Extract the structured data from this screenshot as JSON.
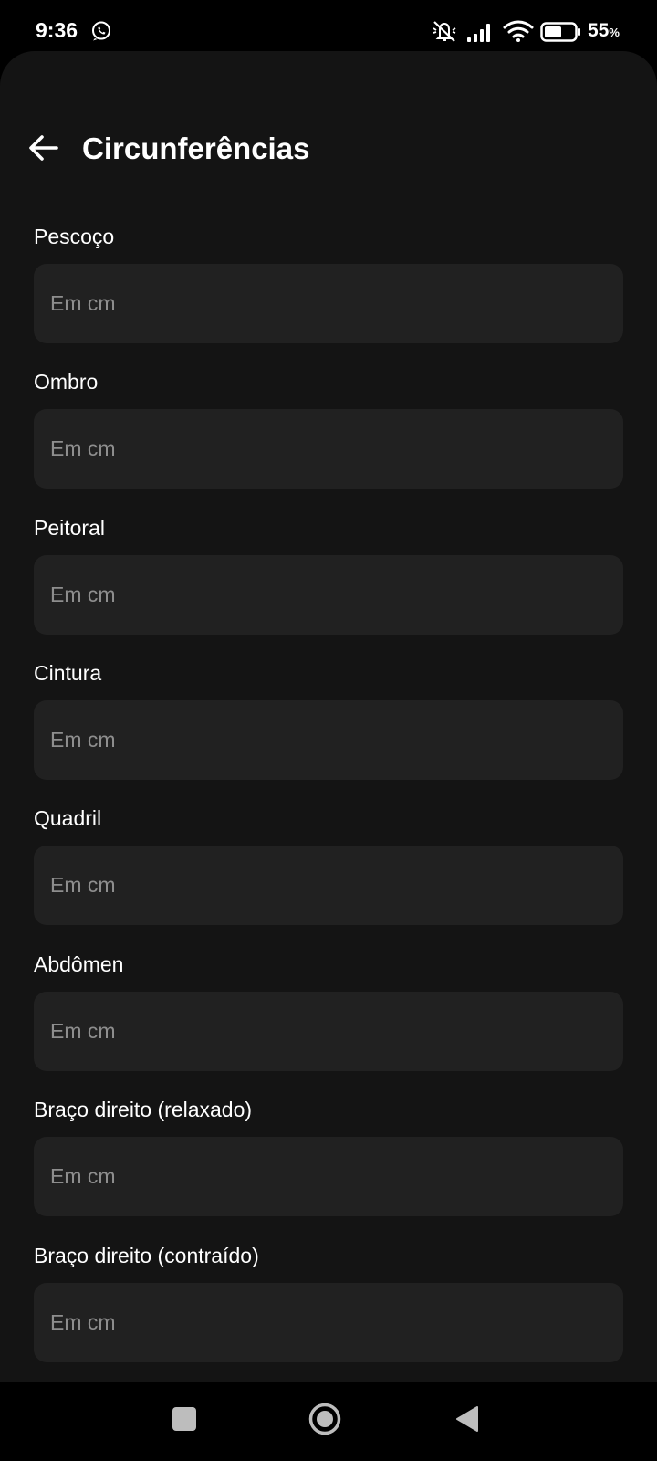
{
  "status_bar": {
    "time": "9:36",
    "battery_level": "55",
    "battery_unit": "%",
    "icons": [
      "whatsapp-icon",
      "mute-icon",
      "signal-icon",
      "wifi-icon",
      "battery-icon"
    ]
  },
  "header": {
    "title": "Circunferências",
    "back_icon": "arrow-left-icon"
  },
  "fields": [
    {
      "label": "Pescoço",
      "placeholder": "Em cm",
      "value": ""
    },
    {
      "label": "Ombro",
      "placeholder": "Em cm",
      "value": ""
    },
    {
      "label": "Peitoral",
      "placeholder": "Em cm",
      "value": ""
    },
    {
      "label": "Cintura",
      "placeholder": "Em cm",
      "value": ""
    },
    {
      "label": "Quadril",
      "placeholder": "Em cm",
      "value": ""
    },
    {
      "label": "Abdômen",
      "placeholder": "Em cm",
      "value": ""
    },
    {
      "label": "Braço direito (relaxado)",
      "placeholder": "Em cm",
      "value": ""
    },
    {
      "label": "Braço direito (contraído)",
      "placeholder": "Em cm",
      "value": ""
    }
  ],
  "nav_bar": {
    "icons": [
      "recents-square-icon",
      "home-circle-icon",
      "back-triangle-icon"
    ]
  },
  "colors": {
    "background": "#141414",
    "input_background": "#212121",
    "placeholder": "#8e8e8e",
    "text": "#ffffff"
  }
}
